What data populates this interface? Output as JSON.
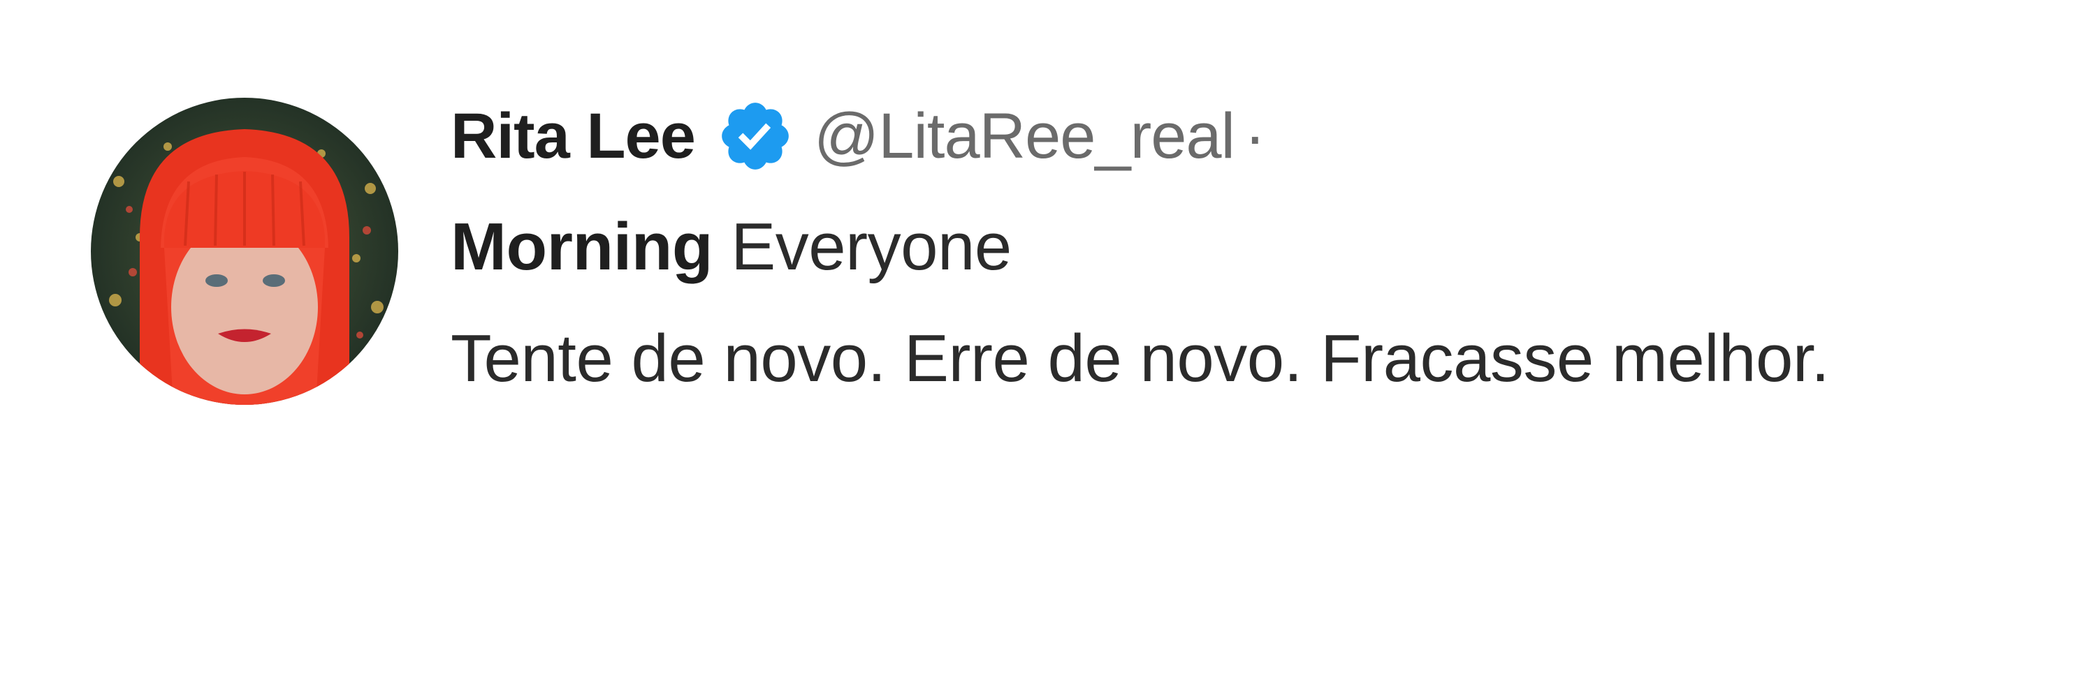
{
  "tweet": {
    "author": {
      "display_name": "Rita Lee",
      "handle": "@LitaRee_real",
      "separator": "·",
      "verified_icon": "verified-badge-icon",
      "avatar_icon": "profile-avatar"
    },
    "text": {
      "bold_word": "Morning",
      "rest_first_line": " Everyone",
      "body": "Tente de novo. Erre de novo. Fracasse melhor."
    }
  },
  "colors": {
    "verified_blue": "#1d9bf0",
    "text": "#2b2b2b",
    "muted": "#6b6b6b"
  }
}
